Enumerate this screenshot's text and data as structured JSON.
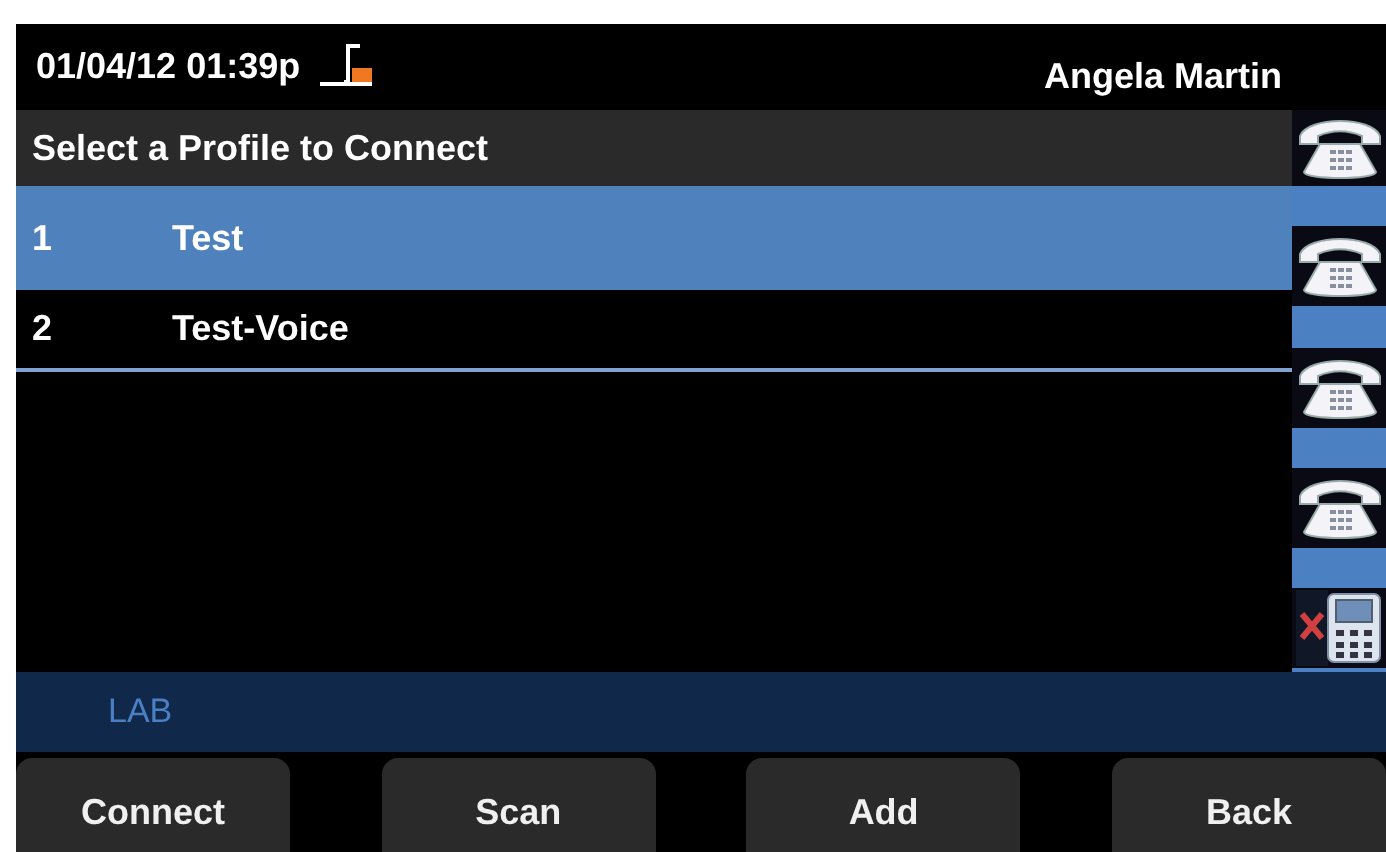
{
  "status_bar": {
    "date_time": "01/04/12 01:39p",
    "user_name": "Angela Martin"
  },
  "title": "Select a Profile to Connect",
  "profiles": [
    {
      "number": "1",
      "name": "Test",
      "selected": true
    },
    {
      "number": "2",
      "name": "Test-Voice",
      "selected": false
    }
  ],
  "line_keys": [
    {
      "kind": "phone"
    },
    {
      "kind": "phone"
    },
    {
      "kind": "phone"
    },
    {
      "kind": "phone"
    },
    {
      "kind": "mobile_disconnected"
    }
  ],
  "label_bar": "LAB",
  "softkeys": [
    "Connect",
    "Scan",
    "Add",
    "Back"
  ]
}
